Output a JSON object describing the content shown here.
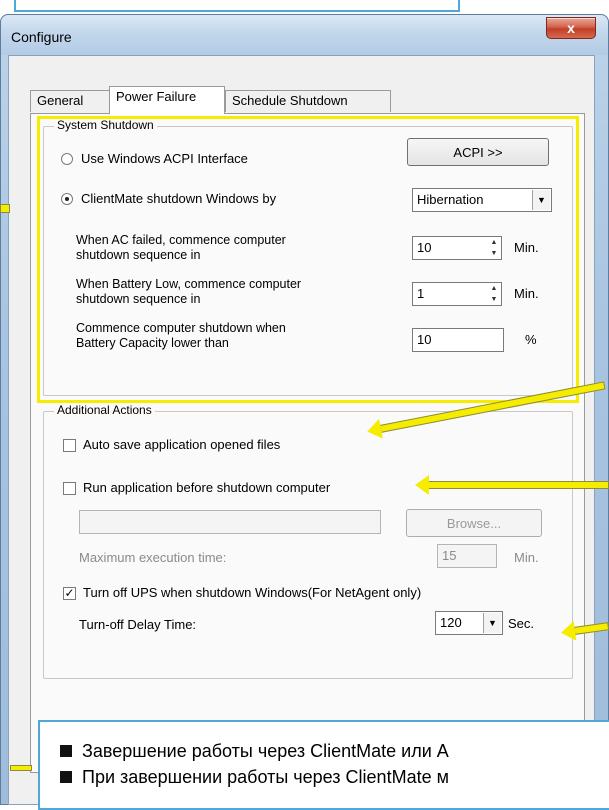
{
  "window": {
    "title": "Configure",
    "close_glyph": "x"
  },
  "tabs": [
    {
      "label": "General",
      "active": false
    },
    {
      "label": "Power Failure",
      "active": true
    },
    {
      "label": "Schedule Shutdown",
      "active": false
    }
  ],
  "system_shutdown": {
    "group_label": "System Shutdown",
    "acpi_radio_label": "Use Windows ACPI Interface",
    "acpi_button": "ACPI >>",
    "clientmate_radio_label": "ClientMate shutdown Windows by",
    "shutdown_method": "Hibernation",
    "ac_failed_label_1": "When AC failed, commence computer",
    "ac_failed_label_2": "shutdown sequence in",
    "ac_failed_value": "10",
    "ac_failed_unit": "Min.",
    "battery_low_label_1": "When Battery Low, commence computer",
    "battery_low_label_2": "shutdown sequence in",
    "battery_low_value": "1",
    "battery_low_unit": "Min.",
    "capacity_label_1": "Commence computer shutdown when",
    "capacity_label_2": "Battery Capacity lower than",
    "capacity_value": "10",
    "capacity_unit": "%"
  },
  "additional_actions": {
    "group_label": "Additional Actions",
    "auto_save_label": "Auto save application opened files",
    "auto_save_checked": false,
    "run_app_label": "Run application before shutdown computer",
    "run_app_checked": false,
    "app_path_value": "",
    "browse_button": "Browse...",
    "max_exec_label": "Maximum execution time:",
    "max_exec_value": "15",
    "max_exec_unit": "Min.",
    "turn_off_ups_label": "Turn off UPS when shutdown Windows(For NetAgent only)",
    "turn_off_ups_checked": true,
    "delay_label": "Turn-off Delay Time:",
    "delay_value": "120",
    "delay_unit": "Sec."
  },
  "annotation": {
    "line1": "Завершение работы через ClientMate или A",
    "line2": "При завершении работы через ClientMate м"
  },
  "colors": {
    "highlight": "#f5ec00",
    "callout_border": "#4fa8d8"
  }
}
